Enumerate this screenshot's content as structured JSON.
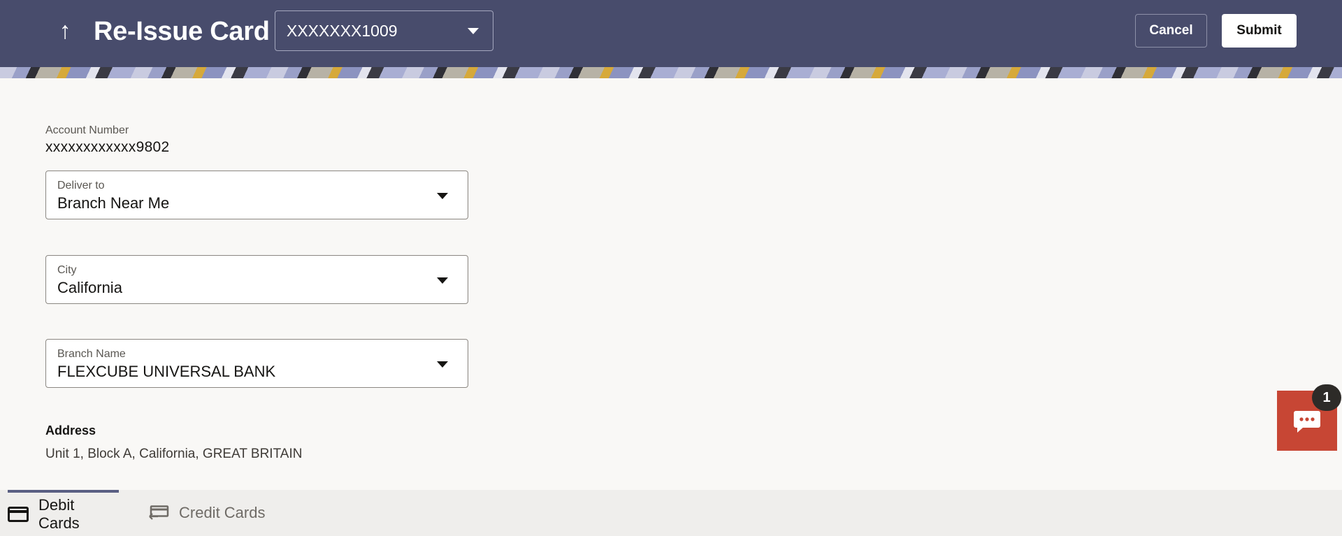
{
  "header": {
    "title": "Re-Issue Card",
    "back_icon": "arrow-up-icon",
    "card_selector": {
      "value": "XXXXXXX1009"
    },
    "cancel_label": "Cancel",
    "submit_label": "Submit"
  },
  "form": {
    "account_number": {
      "label": "Account Number",
      "value": "xxxxxxxxxxxx9802"
    },
    "deliver_to": {
      "label": "Deliver to",
      "value": "Branch Near Me"
    },
    "city": {
      "label": "City",
      "value": "California"
    },
    "branch_name": {
      "label": "Branch Name",
      "value": "FLEXCUBE UNIVERSAL BANK"
    },
    "address": {
      "label": "Address",
      "value": "Unit 1, Block A, California, GREAT BRITAIN"
    }
  },
  "tabs": [
    {
      "label": "Debit Cards",
      "icon": "debit-card-icon",
      "active": true
    },
    {
      "label": "Credit Cards",
      "icon": "credit-card-icon",
      "active": false
    }
  ],
  "chat": {
    "icon": "chat-bubble-icon",
    "badge_count": "1"
  },
  "colors": {
    "header_bg": "#484c6c",
    "page_bg": "#f9f8f6",
    "chat_accent": "#c74634",
    "tab_active_indicator": "#5a5f83"
  }
}
